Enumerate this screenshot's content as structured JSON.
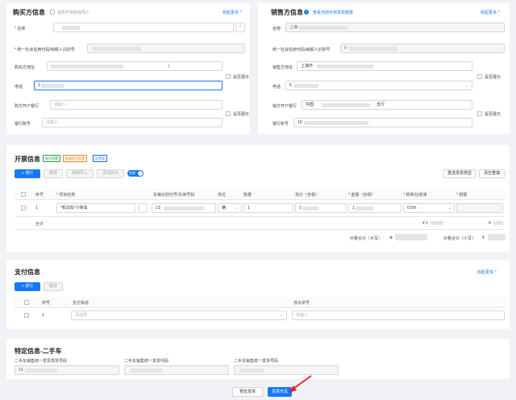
{
  "buyer": {
    "title": "购买方信息",
    "natural_person_label": "是否开票给自然人",
    "more_link": "收起更多 ^",
    "name_label": "* 名称",
    "tax_id_label": "* 统一社会信用代码/纳税人识别号",
    "address_label": "购买方地址",
    "address_value": "|",
    "phone_label": "电话",
    "phone_value": "1",
    "bank_label": "购方开户银行",
    "bank_placeholder": "请输入",
    "account_label": "银行账号",
    "account_placeholder": "请输入",
    "show_label": "是否展示"
  },
  "seller": {
    "title": "销售方信息",
    "link": "查看当前可用发票额度",
    "more_link": "收起更多 ^",
    "name_label": "名称",
    "name_value": "上海",
    "tax_id_label": "统一社会信用代码/纳税人识别号",
    "tax_id_value": "9",
    "address_label": "销售方地址",
    "address_value": "上海市",
    "phone_label": "电话",
    "phone_value": "5",
    "bank_label": "销方开户银行",
    "bank_value_start": "中国",
    "bank_value_end": "支行",
    "account_label": "银行账号",
    "account_value": "10",
    "show_label": "是否展示"
  },
  "invoice": {
    "title": "开票信息",
    "tags": [
      {
        "label": "电子发票",
        "color": "#2e9e4f"
      },
      {
        "label": "普通电子发票",
        "color": "#e08a2b"
      },
      {
        "label": "二手车",
        "color": "#1677ff"
      }
    ],
    "add_row": "+ 增行",
    "delete": "删除",
    "batch_import": "明细导入",
    "add_discount": "添加折扣",
    "toggle_label": "含税",
    "reset_type": "重选发票类型",
    "clear": "清空重填",
    "columns": [
      "序号",
      "* 项目名称",
      "车辆识别代号/车架号码",
      "单位",
      "数量",
      "单价（含税）",
      "* 金额（含税）",
      "* 税率/征收率",
      "* 税额"
    ],
    "row": {
      "index": "1",
      "item_name": "*机动车*小轿车",
      "vin": "LS",
      "unit": "辆",
      "quantity": "1",
      "price": "1",
      "amount": "1",
      "tax_rate": "0.5%"
    },
    "subtotal_label": "合计",
    "subtotal_amount_prefix": "¥ 1",
    "subtotal_tax_prefix": "¥",
    "total_upper_label": "价税合计（大写）",
    "total_upper_value": "⊗",
    "total_lower_label": "价税合计（小写）",
    "total_lower_value": "¥"
  },
  "payment": {
    "title": "支付信息",
    "more_link": "收起更多 ^",
    "add_row": "+ 增行",
    "delete": "删除",
    "columns": [
      "序号",
      "支付渠道",
      "流水单号"
    ],
    "row": {
      "index": "1",
      "channel_placeholder": "请选择",
      "serial_placeholder": "请输入"
    }
  },
  "special": {
    "title": "特定信息-二手车",
    "fields": [
      {
        "label": "二手车销售统一发票发票号码",
        "value": "14"
      },
      {
        "label": "二手车销售统一发票代码",
        "value": ""
      },
      {
        "label": "二手车销售统一发票号码",
        "value": ""
      }
    ]
  },
  "footer": {
    "preview": "预览发票",
    "issue": "发票开具"
  }
}
